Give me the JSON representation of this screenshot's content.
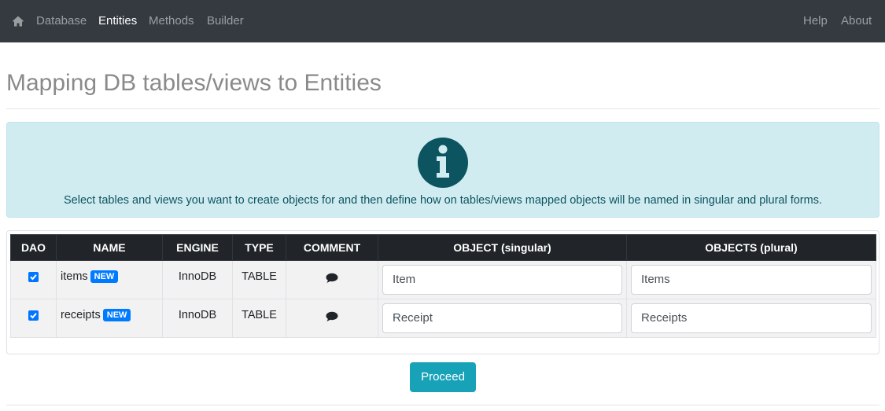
{
  "nav": {
    "home_icon": "home-icon",
    "items": [
      {
        "label": "Database",
        "active": false
      },
      {
        "label": "Entities",
        "active": true
      },
      {
        "label": "Methods",
        "active": false
      },
      {
        "label": "Builder",
        "active": false
      }
    ],
    "right_items": [
      {
        "label": "Help"
      },
      {
        "label": "About"
      }
    ]
  },
  "page": {
    "title": "Mapping DB tables/views to Entities"
  },
  "alert": {
    "icon": "info-icon",
    "text": "Select tables and views you want to create objects for and then define how on tables/views mapped objects will be named in singular and plural forms."
  },
  "table": {
    "headers": {
      "dao": "DAO",
      "name": "NAME",
      "engine": "ENGINE",
      "type": "TYPE",
      "comment": "COMMENT",
      "object_singular": "OBJECT (singular)",
      "objects_plural": "OBJECTS (plural)"
    },
    "rows": [
      {
        "checked": true,
        "name": "items",
        "badge": "NEW",
        "engine": "InnoDB",
        "type": "TABLE",
        "comment_icon": "comment-icon",
        "singular": "Item",
        "plural": "Items"
      },
      {
        "checked": true,
        "name": "receipts",
        "badge": "NEW",
        "engine": "InnoDB",
        "type": "TABLE",
        "comment_icon": "comment-icon",
        "singular": "Receipt",
        "plural": "Receipts"
      }
    ]
  },
  "actions": {
    "proceed_label": "Proceed"
  },
  "colors": {
    "navbar": "#343a40",
    "alert_bg": "#d1ecf1",
    "alert_text": "#0c5460",
    "badge": "#007bff",
    "proceed": "#17a2b8",
    "table_header": "#212529"
  }
}
